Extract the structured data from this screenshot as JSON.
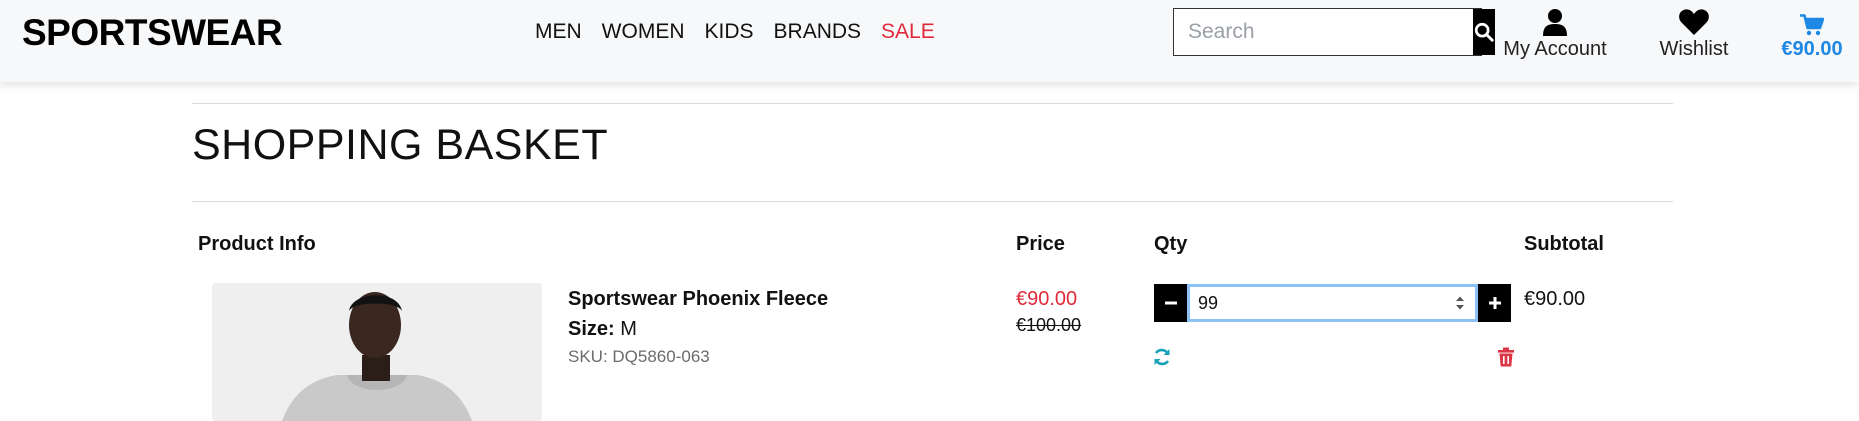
{
  "header": {
    "logo": "SPORTSWEAR",
    "nav": [
      {
        "label": "MEN"
      },
      {
        "label": "WOMEN"
      },
      {
        "label": "KIDS"
      },
      {
        "label": "BRANDS"
      },
      {
        "label": "SALE",
        "highlight_color": "#e02a3b"
      }
    ],
    "search": {
      "placeholder": "Search",
      "value": ""
    },
    "account": {
      "label": "My Account",
      "icon": "user-icon"
    },
    "wishlist": {
      "label": "Wishlist",
      "icon": "heart-icon"
    },
    "cart": {
      "total": "€90.00",
      "icon": "shopping-cart-icon",
      "color": "#1e88e5"
    }
  },
  "basket": {
    "title": "SHOPPING BASKET",
    "columns": {
      "product": "Product Info",
      "price": "Price",
      "qty": "Qty",
      "subtotal": "Subtotal"
    },
    "items": [
      {
        "name": "Sportswear Phoenix Fleece",
        "size_label": "Size:",
        "size": "M",
        "sku": "SKU: DQ5860-063",
        "price": "€90.00",
        "original_price": "€100.00",
        "qty": "99",
        "subtotal": "€90.00"
      }
    ]
  },
  "colors": {
    "sale_red": "#e02a3b",
    "refresh_teal": "#17a2b8",
    "delete_red": "#dc3545"
  }
}
